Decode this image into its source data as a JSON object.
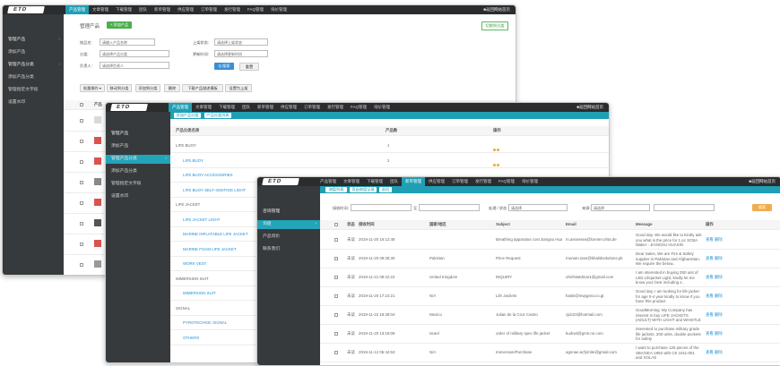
{
  "colors": {
    "topbar": "#2a2c2e",
    "sidebar": "#373a3c",
    "accent": "#1f9fb4",
    "green": "#4cae4c",
    "blue": "#3a8fd4",
    "orange": "#f0ad4e"
  },
  "logo": "ETD",
  "nav": [
    "产品管理",
    "文章管理",
    "下载管理",
    "团队",
    "新单管理",
    "供应管理",
    "订单管理",
    "发行管理",
    "FAQ管理",
    "询价管理"
  ],
  "exit_label": "■返回网站首页",
  "w1": {
    "sidebar": [
      {
        "label": "管理产品"
      },
      {
        "label": "添加产品"
      },
      {
        "label": "管理产品分类"
      },
      {
        "label": "添加产品分类"
      },
      {
        "label": "管理指定文字段"
      },
      {
        "label": "设置水印"
      }
    ],
    "title": "管理产品",
    "add_button": "+ 添加产品",
    "top_right_button": "切换到分类",
    "filters": {
      "name_label": "按品名:",
      "name_placeholder": "请输入产品名称",
      "cat_label": "分类:",
      "cat_value": "请选择产品分类",
      "owner_label": "负责人:",
      "owner_value": "请选择负责人",
      "status_label": "上架状态:",
      "status_value": "请选择上架状态",
      "time_label": "更新时间:",
      "time_value": "请选择更新时间"
    },
    "search_button": "Q 搜索",
    "reset_button": "重置",
    "bulk_buttons": [
      "批量操作 ▾",
      "移动到分类",
      "添加到分类",
      "删除",
      "下载产品描述模板",
      "设置为上架"
    ],
    "col_header": "产品"
  },
  "w2": {
    "sidebar": [
      {
        "label": "管理产品"
      },
      {
        "label": "添加产品"
      },
      {
        "label": "管理产品分类"
      },
      {
        "label": "添加产品分类"
      },
      {
        "label": "管理指定文字段"
      },
      {
        "label": "设置水印"
      }
    ],
    "tabs": [
      "添加产品分类",
      "产品分类列表"
    ],
    "headers": {
      "name": "产品分类名称",
      "count": "产品数",
      "actions": "操作"
    },
    "rows": [
      {
        "name": "LIFE BUOY",
        "count": "1",
        "sub": false
      },
      {
        "name": "LIFE BUOY",
        "count": "2",
        "sub": true
      },
      {
        "name": "LIFE BUOY ACCESSORIES",
        "count": "",
        "sub": true
      },
      {
        "name": "LIFE BUOY SELF-IGNITING LIGHT",
        "count": "",
        "sub": true
      },
      {
        "name": "LIFE JACKET",
        "count": "",
        "sub": false
      },
      {
        "name": "LIFE JACKET LIGHT",
        "count": "",
        "sub": true
      },
      {
        "name": "MARINE INFLATABLE LIFE JACKET",
        "count": "",
        "sub": true
      },
      {
        "name": "MARINE FOAM LIFE JACKET",
        "count": "",
        "sub": true
      },
      {
        "name": "WORK VEST",
        "count": "",
        "sub": true
      },
      {
        "name": "IMMERSION SUIT",
        "count": "",
        "sub": false
      },
      {
        "name": "IMMERSION SUIT",
        "count": "",
        "sub": true
      },
      {
        "name": "SIGNAL",
        "count": "",
        "sub": false
      },
      {
        "name": "PYROTECHNIC SIGNAL",
        "count": "",
        "sub": true
      },
      {
        "name": "OTHERS",
        "count": "",
        "sub": true
      }
    ]
  },
  "w3": {
    "sidebar": [
      {
        "label": "咨询管理"
      },
      {
        "label": "询盘"
      },
      {
        "label": "产品询价"
      },
      {
        "label": "联系我们"
      }
    ],
    "tabs": [
      "询盘列表",
      "导出询盘记录",
      "返回"
    ],
    "filters": {
      "from_label": "接收时间:",
      "to_label": "至",
      "status_label": "处理 / 状态",
      "status_value": "请选择",
      "type_label": "来源:",
      "type_value": "请选择"
    },
    "search_button": "搜索",
    "headers": {
      "status": "状态",
      "time": "接收时间",
      "country": "国家/地区",
      "subject": "Subject",
      "email": "Email",
      "message": "Message",
      "ops": "操作"
    },
    "rows": [
      {
        "status": "未读",
        "time": "2019-11-20 16:12:48",
        "country": "",
        "subject": "Breathing apparatus cost Jiangsu Huaxin Ru(Ja..",
        "email": "m.assessea@lcenter.ohta.de",
        "message": "Good day. We would like to kindly ask you what is the price for 1 pc SCBA Maker - JIANGSU HUAXIN"
      },
      {
        "status": "未读",
        "time": "2019-11-20 09:28:30",
        "country": "Pakistan",
        "subject": "Price Request",
        "email": "munam.nasr@khalidsolutions.pk",
        "message": "Dear Sales, We are Fire & Safety supplier in Pakistan and Afghanistan. We require the below.."
      },
      {
        "status": "未读",
        "time": "2019-11-21 08:22:22",
        "country": "United Kingdom",
        "subject": "INQUIRY",
        "email": "ohnfstwtdmar1@gmail.com",
        "message": "I am interested in buying 250 unit of LED Lifejacket Light, kindly let me know your best including s.."
      },
      {
        "status": "未读",
        "time": "2019-11-20 17:10:21",
        "country": "N/A",
        "subject": "Life Jackets",
        "email": "haski@mvpgrea.co.gt",
        "message": "Good day. I am looking for life jacket for age 0-4 year kindly to know if you have this product"
      },
      {
        "status": "未读",
        "time": "2019-11-22 18:28:04",
        "country": "Mexico",
        "subject": "Julian de la Cruz Castro",
        "email": "cjdc23@hotmail.com",
        "message": "GoodMorning. My Company has interest in buy LIFE JACKETS (ADULT) WITH LIGHT and WHISTLE"
      },
      {
        "status": "未读",
        "time": "2019-11-20 13:18:09",
        "country": "Israel",
        "subject": "order of military spec life jacket",
        "email": "kudnet@gmn.nn.com",
        "message": "interested to purchase military grade life jackets. 200 units, double pockets for safety"
      },
      {
        "status": "未读",
        "time": "2019-11-12 06:44:53",
        "country": "N/A",
        "subject": "Immersion/Purchase",
        "email": "agnnae.acfyrnite@gmail.com",
        "message": "I want to purchase 125 pieces of the SBA/SEA-1992 with CE 1011-001 and SOLAS"
      }
    ],
    "ops": "查看 删除"
  }
}
